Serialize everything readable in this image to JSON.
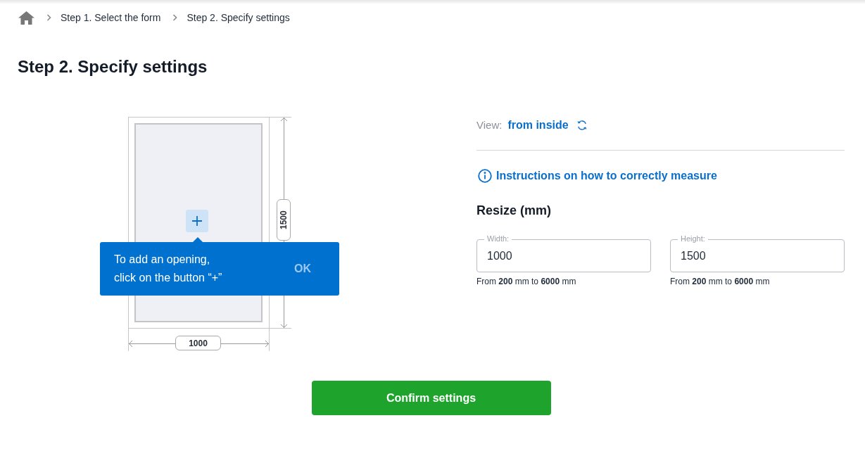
{
  "breadcrumb": {
    "items": [
      "Step 1. Select the form",
      "Step 2. Specify settings"
    ]
  },
  "heading": "Step 2. Specify settings",
  "diagram": {
    "width_label": "1000",
    "height_label": "1500"
  },
  "tooltip": {
    "text": "To add an opening,\nclick on the button “+”",
    "button": "OK"
  },
  "view": {
    "label": "View:",
    "value": "from inside"
  },
  "instructions_link": "Instructions on how to correctly measure",
  "resize": {
    "title": "Resize (mm)",
    "fields": [
      {
        "label": "Width:",
        "value": "1000",
        "hint": "From **200** mm to **6000** mm"
      },
      {
        "label": "Height:",
        "value": "1500",
        "hint": "From **200** mm to **6000** mm"
      }
    ]
  },
  "confirm_button": "Confirm settings"
}
